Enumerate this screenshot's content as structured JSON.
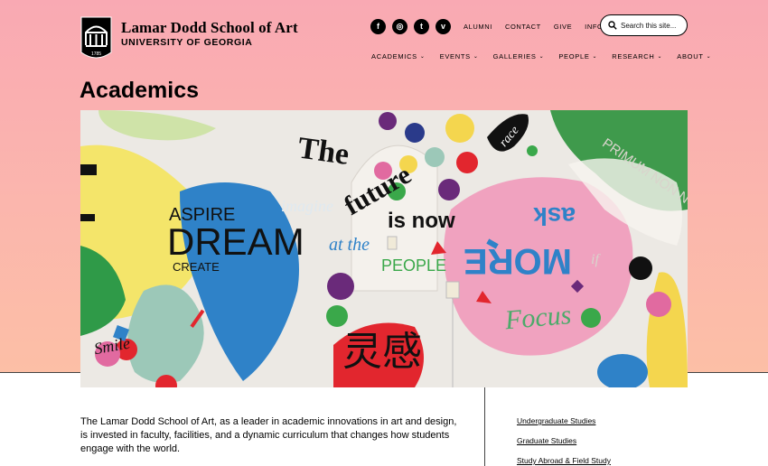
{
  "header": {
    "logo_line1": "Lamar Dodd School of Art",
    "logo_line2": "UNIVERSITY OF GEORGIA",
    "shield_year": "1785",
    "social": [
      {
        "name": "facebook-icon",
        "glyph": "f"
      },
      {
        "name": "instagram-icon",
        "glyph": "◎"
      },
      {
        "name": "twitter-icon",
        "glyph": "t"
      },
      {
        "name": "vimeo-icon",
        "glyph": "v"
      }
    ],
    "utility_links": [
      "ALUMNI",
      "CONTACT",
      "GIVE",
      "INFO FOR..."
    ],
    "search_placeholder": "Search this site...",
    "nav": [
      "ACADEMICS",
      "EVENTS",
      "GALLERIES",
      "PEOPLE",
      "RESEARCH",
      "ABOUT"
    ]
  },
  "page": {
    "title": "Academics"
  },
  "mural_text": {
    "the_future_line1": "The",
    "the_future_line2": "future",
    "the_future_line3": "is now",
    "aspire": "ASPIRE",
    "dream": "DREAM",
    "create": "CREATE",
    "imagine": "imagine",
    "at_the": "at the",
    "people": "PEOPLE",
    "ask": "ask",
    "more": "MORE",
    "focus": "Focus",
    "smile": "Smile",
    "primum": "PRIMUM NON NOCE",
    "if": "if",
    "grace": "race",
    "cjk": "灵感"
  },
  "content": {
    "intro": "The Lamar Dodd School of Art, as a leader in academic innovations in art and design, is invested in faculty, facilities, and a dynamic curriculum that changes how students engage with the world.",
    "side_links": [
      "Undergraduate Studies",
      "Graduate Studies",
      "Study Abroad & Field Study"
    ]
  },
  "colors": {
    "hero_top": "#f9a9b3",
    "hero_bottom": "#fcbfa6",
    "mural_bg": "#ece9e4"
  }
}
